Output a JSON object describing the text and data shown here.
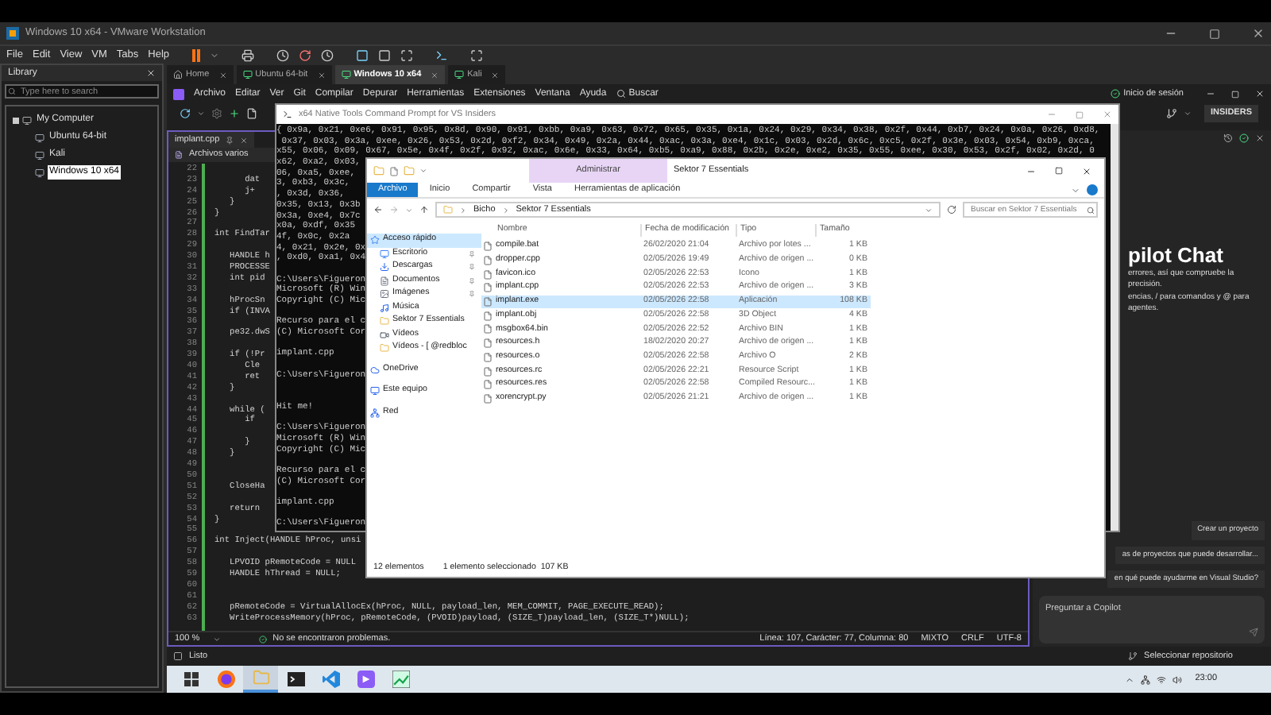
{
  "vmware": {
    "title": "Windows 10 x64 - VMware Workstation",
    "menu": [
      "File",
      "Edit",
      "View",
      "VM",
      "Tabs",
      "Help"
    ],
    "library": {
      "title": "Library",
      "placeholder": "Type here to search",
      "tree": [
        {
          "label": "My Computer",
          "selected": false,
          "children": [
            {
              "label": "Ubuntu 64-bit",
              "selected": false
            },
            {
              "label": "Kali",
              "selected": false
            },
            {
              "label": "Windows 10 x64",
              "selected": true
            }
          ]
        }
      ]
    },
    "tabs": [
      {
        "label": "Home",
        "kind": "home",
        "selected": false
      },
      {
        "label": "Ubuntu 64-bit",
        "kind": "vm",
        "selected": false
      },
      {
        "label": "Windows 10 x64",
        "kind": "vm",
        "selected": true
      },
      {
        "label": "Kali",
        "kind": "vm",
        "selected": false
      }
    ]
  },
  "vs": {
    "menu": [
      "Archivo",
      "Editar",
      "Ver",
      "Git",
      "Compilar",
      "Depurar",
      "Herramientas",
      "Extensiones",
      "Ventana",
      "Ayuda"
    ],
    "search": "Buscar",
    "sign_in": "Inicio de sesión",
    "badge": "INSIDERS",
    "editor_tab": "implant.cpp",
    "scope": "Archivos varios",
    "code": [
      {
        "n": "22"
      },
      {
        "n": "23",
        "text": "      dat"
      },
      {
        "n": "24",
        "text": "      j+"
      },
      {
        "n": "25",
        "text": "   }"
      },
      {
        "n": "26",
        "text": "}"
      },
      {
        "n": "27"
      },
      {
        "n": "28",
        "text": "int FindTar"
      },
      {
        "n": "29"
      },
      {
        "n": "30",
        "text": "   HANDLE h"
      },
      {
        "n": "31",
        "text": "   PROCESSE"
      },
      {
        "n": "32",
        "text": "   int pid"
      },
      {
        "n": "33"
      },
      {
        "n": "34",
        "text": "   hProcSn"
      },
      {
        "n": "35",
        "text": "   if (INVA"
      },
      {
        "n": "36"
      },
      {
        "n": "37",
        "text": "   pe32.dwS"
      },
      {
        "n": "38"
      },
      {
        "n": "39",
        "text": "   if (!Pr"
      },
      {
        "n": "40",
        "text": "      Cle"
      },
      {
        "n": "41",
        "text": "      ret"
      },
      {
        "n": "42",
        "text": "   }"
      },
      {
        "n": "43"
      },
      {
        "n": "44",
        "text": "   while ("
      },
      {
        "n": "45",
        "text": "      if"
      },
      {
        "n": "46"
      },
      {
        "n": "47",
        "text": "      }"
      },
      {
        "n": "48",
        "text": "   }"
      },
      {
        "n": "49"
      },
      {
        "n": "50"
      },
      {
        "n": "51",
        "text": "   CloseHa"
      },
      {
        "n": "52"
      },
      {
        "n": "53",
        "text": "   return"
      },
      {
        "n": "54",
        "text": "}"
      },
      {
        "n": "55"
      },
      {
        "n": "56",
        "text": "int Inject(HANDLE hProc, unsi"
      },
      {
        "n": "57"
      },
      {
        "n": "58",
        "text": "   LPVOID pRemoteCode = NULL"
      },
      {
        "n": "59",
        "text": "   HANDLE hThread = NULL;"
      },
      {
        "n": "60"
      },
      {
        "n": "61"
      },
      {
        "n": "62",
        "text": "   pRemoteCode = VirtualAllocEx(hProc, NULL, payload_len, MEM_COMMIT, PAGE_EXECUTE_READ);"
      },
      {
        "n": "63",
        "text": "   WriteProcessMemory(hProc, pRemoteCode, (PVOID)payload, (SIZE_T)payload_len, (SIZE_T*)NULL);"
      }
    ],
    "zoom": "100 %",
    "problems": "No se encontraron problemas.",
    "position": "Línea: 107, Carácter: 77, Columna: 80",
    "status_items": [
      "MIXTO",
      "CRLF",
      "UTF-8"
    ],
    "status": "Listo",
    "repo": "Seleccionar repositorio",
    "copilot": {
      "title": "pilot Chat",
      "lines": [
        "errores, así que compruebe la precisión.",
        "encias, / para comandos y @ para agentes."
      ],
      "suggestions": [
        "Crear un proyecto",
        "as de proyectos que puede desarrollar...",
        "en qué puede ayudarme en Visual Studio?"
      ],
      "placeholder": "Preguntar a Copilot"
    }
  },
  "cmd": {
    "title": "x64 Native Tools Command Prompt for VS Insiders",
    "blocks": [
      [
        "{ 0x9a, 0x21, 0xe6, 0x91, 0x95, 0x8d, 0x90, 0x91, 0xbb, 0xa9, 0x63, 0x72, 0x65, 0x35, 0x1a, 0x24, 0x29, 0x34, 0x38, 0x2f, 0x44, 0xb7, 0x24, 0x0a, 0x26, 0xd8,",
        " 0x37, 0x03, 0x3a, 0xee, 0x26, 0x53, 0x2d, 0xf2, 0x34, 0x49, 0x2a, 0x44, 0xac, 0x3a, 0xe4, 0x1c, 0x03, 0x2d, 0x6c, 0xc5, 0x2f, 0x3e, 0x03, 0x54, 0xb9, 0xca,",
        "x55, 0x06, 0x09, 0x67, 0x5e, 0x4f, 0x2f, 0x92, 0xac, 0x6e, 0x33, 0x64, 0xb5, 0xa9, 0x88, 0x2b, 0x2e, 0xe2, 0x35, 0x55, 0xee, 0x30, 0x53, 0x2f, 0x02, 0x2d, 0",
        "x62, 0xa2, 0x03,",
        "06, 0xa5, 0xee,",
        "3, 0xb3, 0x3c,",
        ", 0x3d, 0x36,",
        "0x35, 0x13, 0x3b",
        "0x3a, 0xe4, 0x7c",
        "x0a, 0xdf, 0x35",
        "4f, 0x0c, 0x2a",
        "4, 0x21, 0x2e, 0x",
        ", 0xd0, 0xa1, 0x4"
      ],
      [
        "C:\\Users\\Figueron",
        "Microsoft (R) Win",
        "Copyright (C) Mic"
      ],
      [
        "Recurso para el c",
        "(C) Microsoft Cor"
      ],
      [
        "implant.cpp"
      ],
      [
        "C:\\Users\\Figueron"
      ],
      [
        "Hit me!"
      ],
      [
        "C:\\Users\\Figueron",
        "Microsoft (R) Win",
        "Copyright (C) Mic"
      ],
      [
        "Recurso para el c",
        "(C) Microsoft Cor"
      ],
      [
        "implant.cpp"
      ],
      [
        "C:\\Users\\Figueron"
      ]
    ]
  },
  "explorer": {
    "title": "Sektor 7 Essentials",
    "context_tab": "Administrar",
    "ribbon_tabs": [
      {
        "label": "Archivo",
        "selected": true
      },
      {
        "label": "Inicio",
        "selected": false
      },
      {
        "label": "Compartir",
        "selected": false
      },
      {
        "label": "Vista",
        "selected": false
      },
      {
        "label": "Herramientas de aplicación",
        "selected": false
      }
    ],
    "path": [
      "Bicho",
      "Sektor 7 Essentials"
    ],
    "search_placeholder": "Buscar en Sektor 7 Essentials",
    "nav": [
      {
        "label": "Acceso rápido",
        "kind": "star",
        "selected": true,
        "pinned": false
      },
      {
        "label": "Escritorio",
        "kind": "desktop",
        "selected": false,
        "pinned": true
      },
      {
        "label": "Descargas",
        "kind": "download",
        "selected": false,
        "pinned": true
      },
      {
        "label": "Documentos",
        "kind": "document",
        "selected": false,
        "pinned": true
      },
      {
        "label": "Imágenes",
        "kind": "image",
        "selected": false,
        "pinned": true
      },
      {
        "label": "Música",
        "kind": "music",
        "selected": false,
        "pinned": false
      },
      {
        "label": "Sektor 7 Essentials",
        "kind": "folder",
        "selected": false,
        "pinned": false
      },
      {
        "label": "Vídeos",
        "kind": "video",
        "selected": false,
        "pinned": false
      },
      {
        "label": "Vídeos - [ @redbloc",
        "kind": "folder",
        "selected": false,
        "pinned": false
      },
      {
        "label": "OneDrive",
        "kind": "cloud",
        "selected": false,
        "pinned": false
      },
      {
        "label": "Este equipo",
        "kind": "computer",
        "selected": false,
        "pinned": false
      },
      {
        "label": "Red",
        "kind": "network",
        "selected": false,
        "pinned": false
      }
    ],
    "columns": [
      "Nombre",
      "Fecha de modificación",
      "Tipo",
      "Tamaño"
    ],
    "files": [
      {
        "name": "compile.bat",
        "date": "26/02/2020 21:04",
        "type": "Archivo por lotes ...",
        "size": "1 KB",
        "selected": false
      },
      {
        "name": "dropper.cpp",
        "date": "02/05/2026 19:49",
        "type": "Archivo de origen ...",
        "size": "0 KB",
        "selected": false
      },
      {
        "name": "favicon.ico",
        "date": "02/05/2026 22:53",
        "type": "Icono",
        "size": "1 KB",
        "selected": false
      },
      {
        "name": "implant.cpp",
        "date": "02/05/2026 22:53",
        "type": "Archivo de origen ...",
        "size": "3 KB",
        "selected": false
      },
      {
        "name": "implant.exe",
        "date": "02/05/2026 22:58",
        "type": "Aplicación",
        "size": "108 KB",
        "selected": true
      },
      {
        "name": "implant.obj",
        "date": "02/05/2026 22:58",
        "type": "3D Object",
        "size": "4 KB",
        "selected": false
      },
      {
        "name": "msgbox64.bin",
        "date": "02/05/2026 22:52",
        "type": "Archivo BIN",
        "size": "1 KB",
        "selected": false
      },
      {
        "name": "resources.h",
        "date": "18/02/2020 20:27",
        "type": "Archivo de origen ...",
        "size": "1 KB",
        "selected": false
      },
      {
        "name": "resources.o",
        "date": "02/05/2026 22:58",
        "type": "Archivo O",
        "size": "2 KB",
        "selected": false
      },
      {
        "name": "resources.rc",
        "date": "02/05/2026 22:21",
        "type": "Resource Script",
        "size": "1 KB",
        "selected": false
      },
      {
        "name": "resources.res",
        "date": "02/05/2026 22:58",
        "type": "Compiled Resourc...",
        "size": "1 KB",
        "selected": false
      },
      {
        "name": "xorencrypt.py",
        "date": "02/05/2026 21:21",
        "type": "Archivo de origen ...",
        "size": "1 KB",
        "selected": false
      }
    ],
    "count": "12 elementos",
    "selection": "1 elemento seleccionado  107 KB"
  },
  "taskbar": {
    "apps": [
      {
        "kind": "start",
        "selected": false
      },
      {
        "kind": "browser",
        "selected": false
      },
      {
        "kind": "folder",
        "selected": true
      },
      {
        "kind": "terminal",
        "selected": false
      },
      {
        "kind": "code",
        "selected": false
      },
      {
        "kind": "studio",
        "selected": false
      },
      {
        "kind": "chart",
        "selected": false
      }
    ],
    "clock": "23:00"
  }
}
